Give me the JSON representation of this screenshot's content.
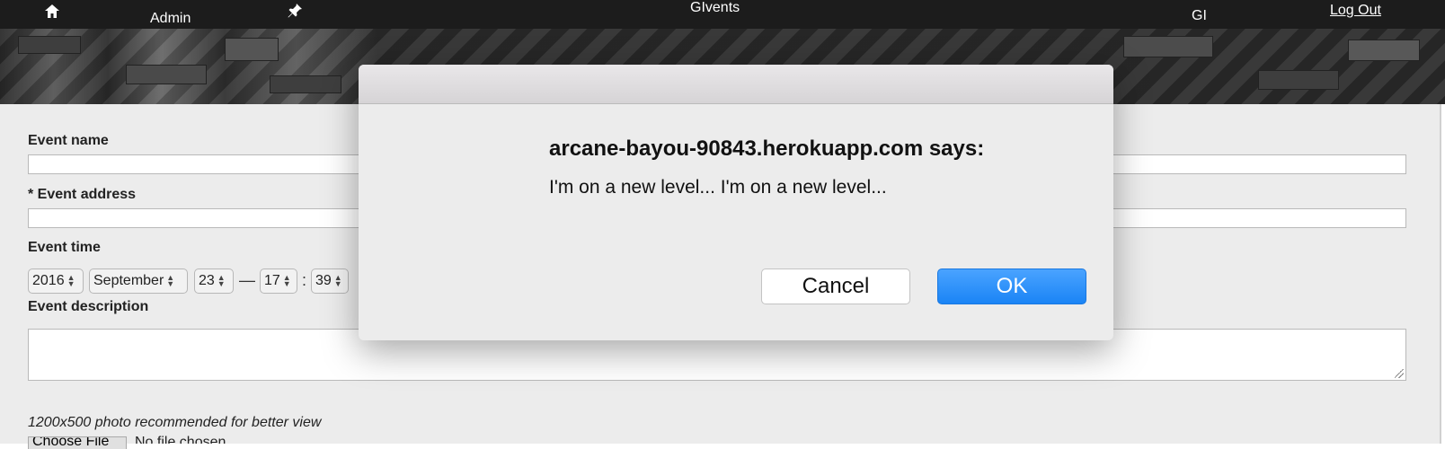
{
  "nav": {
    "admin": "Admin",
    "brand": "GIvents",
    "gi": "GI",
    "logout": "Log Out"
  },
  "form": {
    "event_name_label": "Event name",
    "event_address_label": "* Event address",
    "event_time_label": "Event time",
    "time": {
      "year": "2016",
      "month": "September",
      "day": "23",
      "dash": "—",
      "hour": "17",
      "colon": ":",
      "minute": "39"
    },
    "event_description_label": "Event description",
    "photo_hint": "1200x500 photo recommended for better view",
    "choose_file": "Choose File",
    "no_file": "No file chosen"
  },
  "dialog": {
    "heading": "arcane-bayou-90843.herokuapp.com says:",
    "message": "I'm on a new level... I'm on a new level...",
    "cancel": "Cancel",
    "ok": "OK"
  },
  "colors": {
    "topbar": "#1c1c1c",
    "ok_button": "#1a84f5",
    "content_bg": "#ececec"
  },
  "icons": [
    "home-icon",
    "pin-icon"
  ]
}
